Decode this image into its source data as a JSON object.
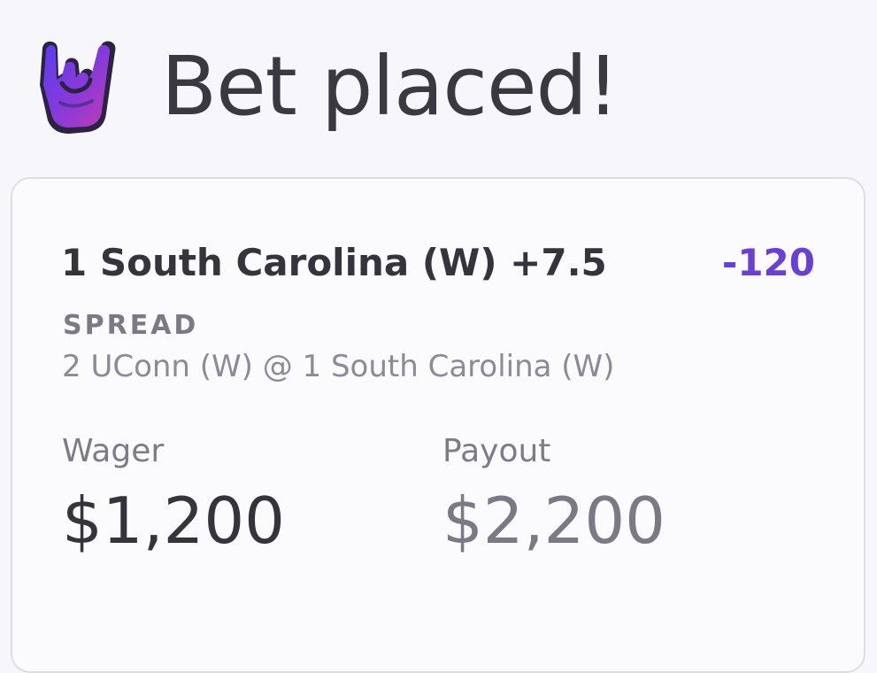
{
  "header": {
    "title": "Bet placed!",
    "icon": "rock-on-hand-icon"
  },
  "bet": {
    "selection": "1 South Carolina (W) +7.5",
    "odds": "-120",
    "market": "SPREAD",
    "matchup": "2 UConn (W) @ 1 South Carolina (W)",
    "wager_label": "Wager",
    "wager_value": "$1,200",
    "payout_label": "Payout",
    "payout_value": "$2,200"
  },
  "colors": {
    "accent": "#6a3fd6",
    "text_primary": "#35343d",
    "text_secondary": "#7a7985",
    "card_border": "#dedde6",
    "background": "#f7f7fb"
  }
}
